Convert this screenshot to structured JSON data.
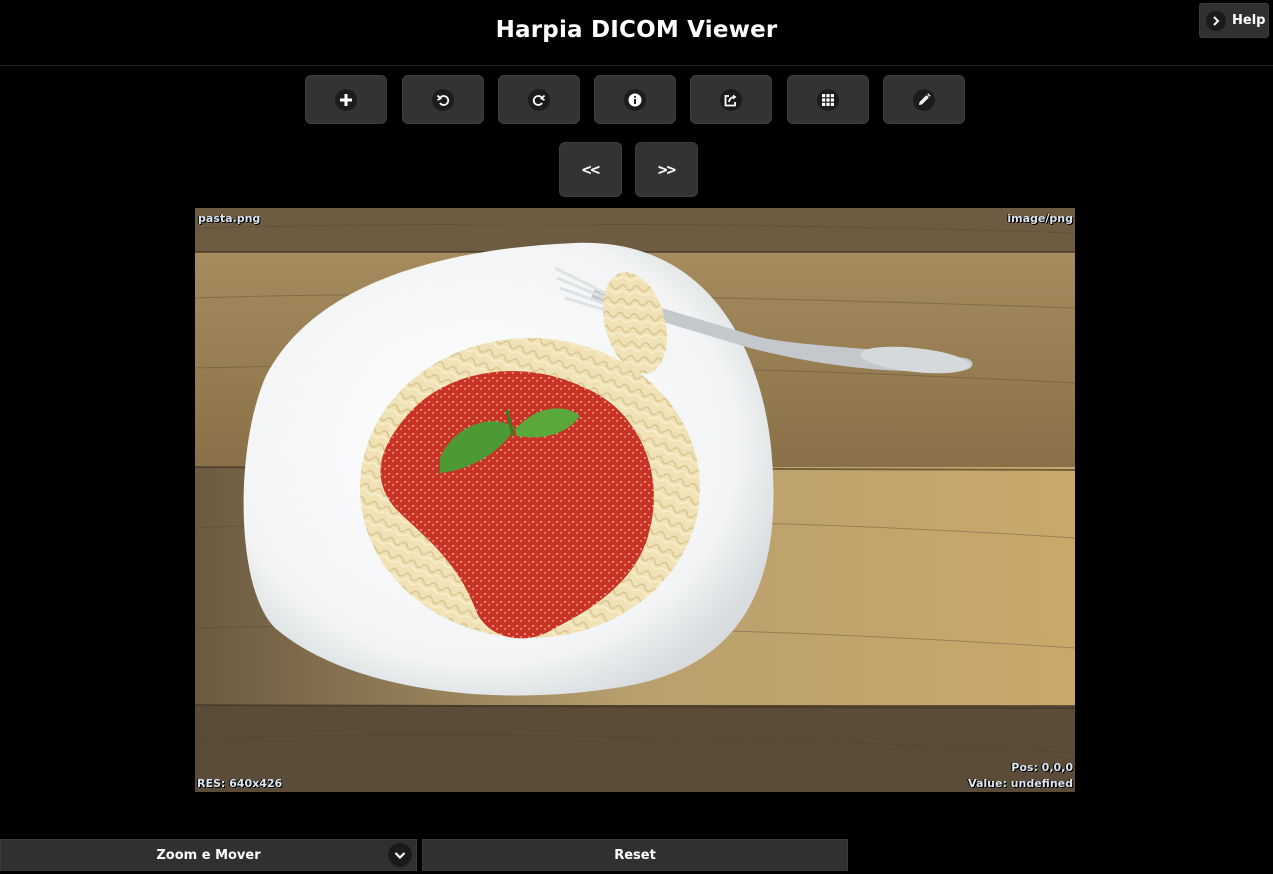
{
  "header": {
    "title": "Harpia DICOM Viewer",
    "help_label": "Help"
  },
  "toolbar": {
    "tools": [
      {
        "name": "add-button",
        "icon": "plus-icon"
      },
      {
        "name": "rotate-left-button",
        "icon": "rotate-left-icon"
      },
      {
        "name": "rotate-right-button",
        "icon": "rotate-right-icon"
      },
      {
        "name": "info-button",
        "icon": "info-icon"
      },
      {
        "name": "export-button",
        "icon": "share-icon"
      },
      {
        "name": "grid-button",
        "icon": "grid-icon"
      },
      {
        "name": "draw-button",
        "icon": "pencil-icon"
      }
    ],
    "prev_label": "<<",
    "next_label": ">>"
  },
  "viewer": {
    "filename": "pasta.png",
    "mimetype": "image/png",
    "resolution": "RES: 640x426",
    "position": "Pos: 0,0,0",
    "value": "Value: undefined"
  },
  "controls": {
    "mode_selected": "Zoom e Mover",
    "reset_label": "Reset"
  },
  "colors": {
    "background": "#000000",
    "button": "#333333",
    "overlay_text": "#dde6f0"
  }
}
